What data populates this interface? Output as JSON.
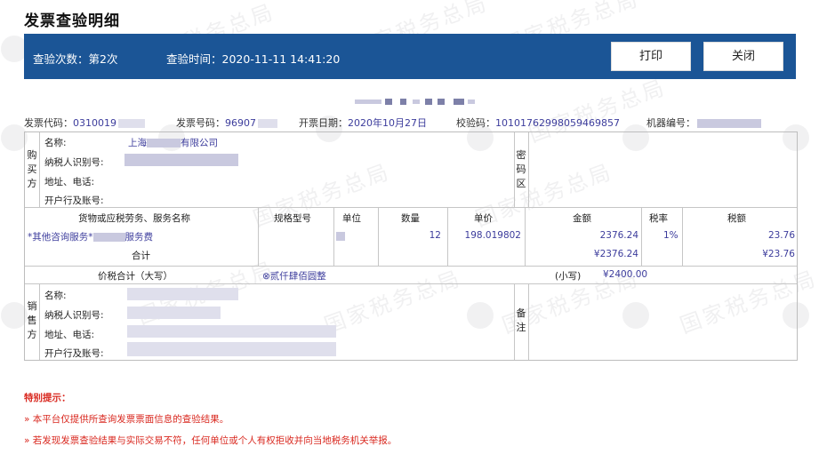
{
  "page_title": "发票查验明细",
  "topbar": {
    "check_count_label": "查验次数：第2次",
    "check_time_label": "查验时间：",
    "check_time_value": "2020-11-11 14:41:20",
    "print_label": "打印",
    "close_label": "关闭"
  },
  "watermark": {
    "text": "国家税务总局"
  },
  "header": {
    "code_label": "发票代码：",
    "code_value": "0310019",
    "number_label": "发票号码：",
    "number_value": "96907",
    "date_label": "开票日期：",
    "date_value": "2020年10月27日",
    "check_code_label": "校验码：",
    "check_code_value": "10101762998059469857",
    "machine_label": "机器编号："
  },
  "buyer": {
    "side_label": "购买方",
    "name_label": "名称:",
    "name_value_prefix": "上海",
    "name_value_suffix": "有限公司",
    "tax_id_label": "纳税人识别号:",
    "address_label": "地址、电话:",
    "bank_label": "开户行及账号:",
    "cipher_label": "密码区"
  },
  "items": {
    "columns": [
      "货物或应税劳务、服务名称",
      "规格型号",
      "单位",
      "数量",
      "单价",
      "金额",
      "税率",
      "税额"
    ],
    "rows": [
      {
        "name_prefix": "*其他咨询服务*",
        "name_suffix": "服务费",
        "spec": "",
        "unit": "",
        "quantity": "12",
        "price": "198.019802",
        "amount": "2376.24",
        "rate": "1%",
        "tax": "23.76"
      }
    ],
    "subtotal_label": "合计",
    "subtotal_amount": "¥2376.24",
    "subtotal_tax": "¥23.76"
  },
  "total": {
    "label": "价税合计（大写）",
    "words": "⊗贰仟肆佰圆整",
    "small_label": "(小写)",
    "small_value": "¥2400.00"
  },
  "seller": {
    "side_label": "销售方",
    "name_label": "名称:",
    "tax_id_label": "纳税人识别号:",
    "address_label": "地址、电话:",
    "bank_label": "开户行及账号:",
    "remark_label": "备注"
  },
  "notes": {
    "title": "特别提示：",
    "lines": [
      "»  本平台仅提供所查询发票票面信息的查验结果。",
      "»  若发现发票查验结果与实际交易不符，任何单位或个人有权拒收并向当地税务机关举报。"
    ]
  }
}
